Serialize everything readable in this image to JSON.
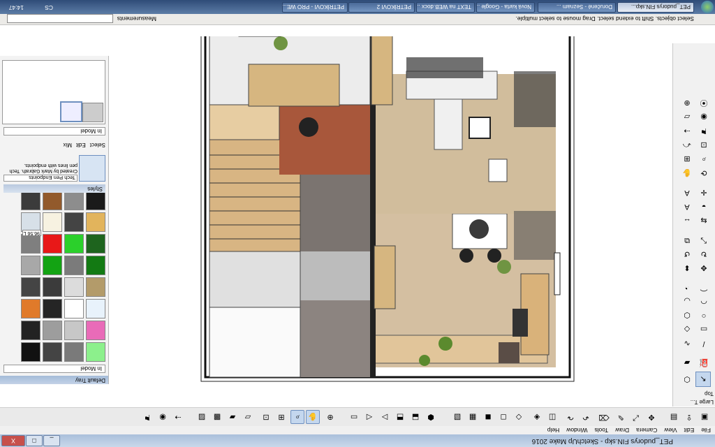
{
  "window": {
    "title": "PET_pudorys FIN.skp - SketchUp Make 2016",
    "buttons": [
      "_",
      "□",
      "X"
    ]
  },
  "menu": [
    "File",
    "Edit",
    "View",
    "Camera",
    "Draw",
    "Tools",
    "Window",
    "Help"
  ],
  "large_tool_set": {
    "title": "Large T...",
    "view_label": "Top"
  },
  "status": {
    "hint": "Select objects. Shift to extend select. Drag mouse to select multiple.",
    "measurements_label": "Measurements"
  },
  "tray": {
    "title": "Default Tray",
    "in_model": "In Model",
    "value_chip": "96.56 L",
    "styles_header": "Styles",
    "style_name": "Tech Pen Endpoints",
    "style_desc": "Created by Mark Gabrath. Tech pen lines with endpoints.",
    "tabs": [
      "Select",
      "Edit",
      "Mix"
    ]
  },
  "taskbar": {
    "time": "14:47",
    "lang": "CS",
    "tasks": [
      "PETRÍKOVI - PRO WE...",
      "Doručené - Seznam ...",
      "Nová karta - Google ...",
      "TEXT na WEB.docx ...",
      "PETRÍKOVI 2",
      "PET_pudorys FIN.skp..."
    ]
  },
  "colors": {
    "accent": "#6d8fbf",
    "titlebar": "#a9bfdb",
    "wood": "#d9b27a",
    "tile": "#7b7470",
    "floor_wood": "#c9a37a",
    "parquet": "#a8573b"
  },
  "swatches": [
    "#8cf08c",
    "#7a7a7a",
    "#444444",
    "#111111",
    "#e96bb8",
    "#c7c7c7",
    "#9d9d9d",
    "#222222",
    "#e8f2fb",
    "#ffffff",
    "#252525",
    "#e07a2a",
    "#b39b6a",
    "#dcdcdc",
    "#3b3b3b",
    "#444444",
    "#137a13",
    "#7b7b7b",
    "#13a313",
    "#a8a8a8",
    "#1e641e",
    "#2bd02b",
    "#e81818",
    "#7f7f7f",
    "#e2b45c",
    "#444444",
    "#f7f2e1",
    "#d7e0e8",
    "#1a1a1a",
    "#8d8d8d",
    "#925a2c",
    "#3b3b3b"
  ]
}
